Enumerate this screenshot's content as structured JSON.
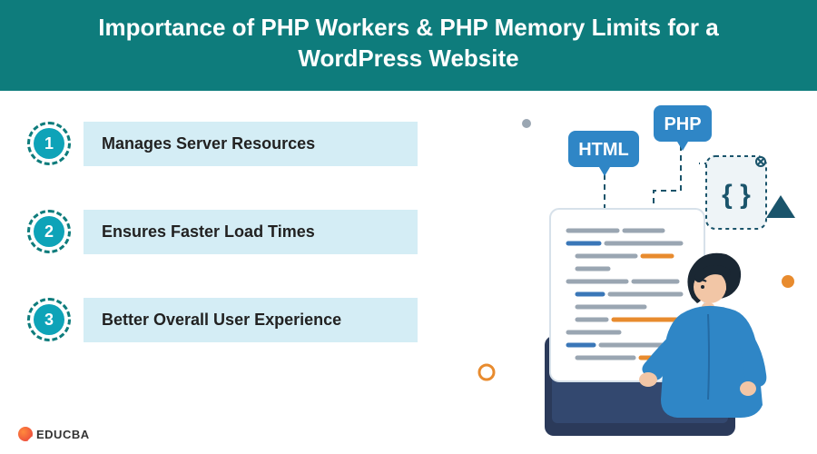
{
  "header": {
    "title": "Importance of PHP Workers & PHP Memory Limits for a WordPress Website"
  },
  "list": {
    "items": [
      {
        "num": "1",
        "label": "Manages Server Resources"
      },
      {
        "num": "2",
        "label": "Ensures Faster Load Times"
      },
      {
        "num": "3",
        "label": "Better Overall User Experience"
      }
    ]
  },
  "illustration": {
    "tags": {
      "html": "HTML",
      "php": "PHP"
    }
  },
  "brand": {
    "name": "EDUCBA"
  },
  "colors": {
    "header_bg": "#0e7c7c",
    "accent": "#0ea3b8",
    "panel": "#d4edf5",
    "tag_html": "#2f86c6",
    "tag_php": "#2f86c6",
    "code_blue": "#3a77b8",
    "code_orange": "#e88b2e",
    "code_gray": "#9aa6b2"
  }
}
